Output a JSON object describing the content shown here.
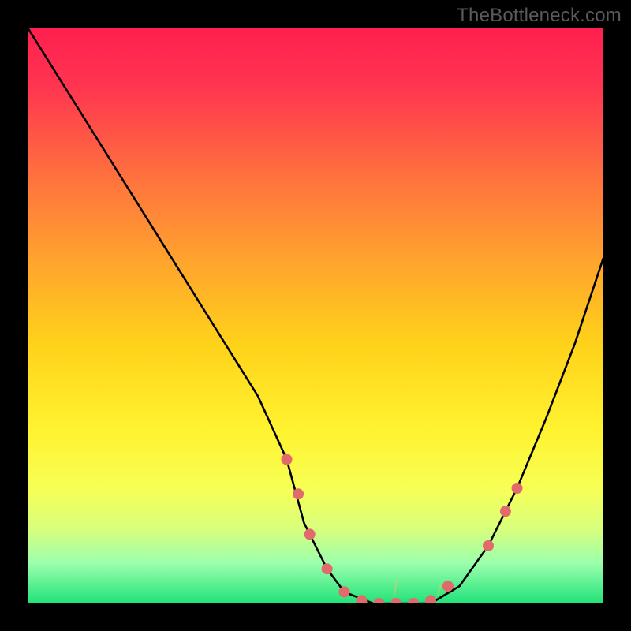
{
  "watermark": "TheBottleneck.com",
  "colors": {
    "background": "#000000",
    "curve": "#000000",
    "dots": "#e16a6a",
    "gradient_stops": [
      {
        "offset": 0.0,
        "color": "#ff1f4f"
      },
      {
        "offset": 0.1,
        "color": "#ff3450"
      },
      {
        "offset": 0.25,
        "color": "#ff6e3f"
      },
      {
        "offset": 0.4,
        "color": "#ffa22e"
      },
      {
        "offset": 0.55,
        "color": "#ffd21a"
      },
      {
        "offset": 0.7,
        "color": "#fff330"
      },
      {
        "offset": 0.8,
        "color": "#f7ff55"
      },
      {
        "offset": 0.87,
        "color": "#d8ff7c"
      },
      {
        "offset": 0.93,
        "color": "#9cffad"
      },
      {
        "offset": 1.0,
        "color": "#20e27a"
      }
    ]
  },
  "chart_data": {
    "type": "line",
    "title": "",
    "xlabel": "",
    "ylabel": "",
    "xlim": [
      0,
      100
    ],
    "ylim": [
      0,
      100
    ],
    "series": [
      {
        "name": "curve",
        "x": [
          0,
          5,
          10,
          15,
          20,
          25,
          30,
          35,
          40,
          45,
          48,
          52,
          55,
          60,
          65,
          70,
          75,
          80,
          85,
          90,
          95,
          100
        ],
        "y": [
          100,
          92,
          84,
          76,
          68,
          60,
          52,
          44,
          36,
          25,
          14,
          6,
          2,
          0,
          0,
          0,
          3,
          10,
          20,
          32,
          45,
          60
        ]
      }
    ],
    "annotations": {
      "dots": [
        {
          "x": 45,
          "y": 25
        },
        {
          "x": 47,
          "y": 19
        },
        {
          "x": 49,
          "y": 12
        },
        {
          "x": 52,
          "y": 6
        },
        {
          "x": 55,
          "y": 2
        },
        {
          "x": 58,
          "y": 0.5
        },
        {
          "x": 61,
          "y": 0
        },
        {
          "x": 64,
          "y": 0
        },
        {
          "x": 67,
          "y": 0
        },
        {
          "x": 70,
          "y": 0.5
        },
        {
          "x": 73,
          "y": 3
        },
        {
          "x": 80,
          "y": 10
        },
        {
          "x": 83,
          "y": 16
        },
        {
          "x": 85,
          "y": 20
        }
      ]
    }
  }
}
